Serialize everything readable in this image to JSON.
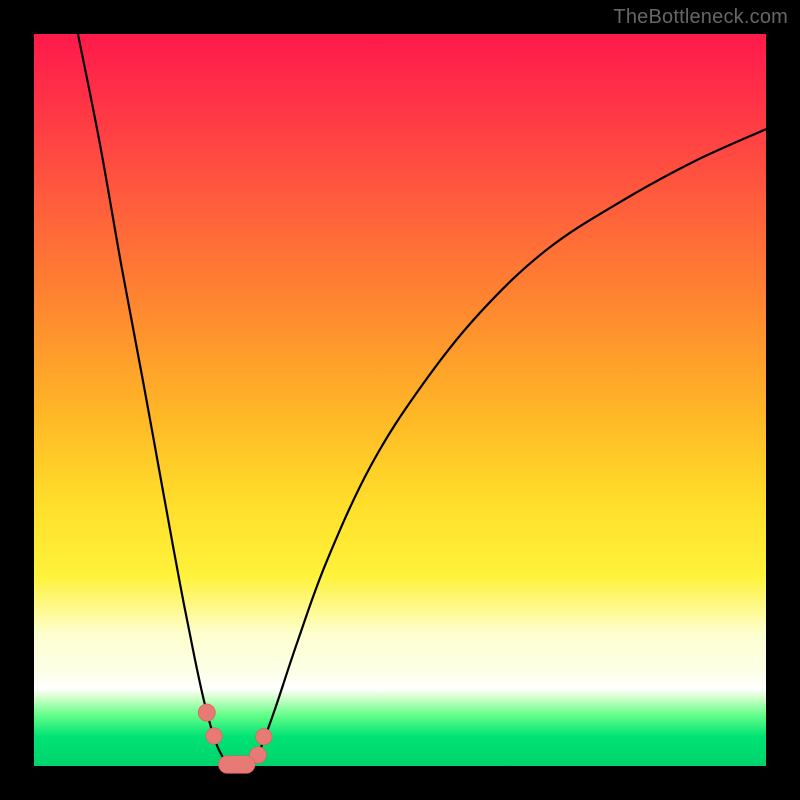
{
  "watermark": "TheBottleneck.com",
  "chart_data": {
    "type": "line",
    "title": "",
    "xlabel": "",
    "ylabel": "",
    "xlim": [
      0,
      100
    ],
    "ylim": [
      0,
      100
    ],
    "grid": false,
    "legend": false,
    "series": [
      {
        "name": "left-branch",
        "x": [
          6,
          9,
          12,
          15,
          17,
          19,
          20.5,
          22,
          23.2,
          24.2,
          25,
          25.8,
          26.4
        ],
        "values": [
          100,
          85,
          68,
          52,
          41,
          30,
          22,
          14.5,
          9,
          5.2,
          2.8,
          1.2,
          0.3
        ]
      },
      {
        "name": "right-branch",
        "x": [
          30,
          31,
          33,
          36,
          40,
          46,
          53,
          61,
          70,
          80,
          90,
          100
        ],
        "values": [
          0.3,
          2.5,
          8,
          17,
          28,
          41,
          52,
          62,
          70.5,
          77,
          82.5,
          87
        ]
      }
    ],
    "flat_bottom": {
      "x_start": 26.4,
      "x_end": 30,
      "y": 0
    },
    "markers": [
      {
        "name": "left-upper-dot",
        "x": 23.6,
        "y": 7.3,
        "r": 1.3
      },
      {
        "name": "left-lower-dot",
        "x": 24.6,
        "y": 4.1,
        "r": 1.1
      },
      {
        "name": "right-upper-dot",
        "x": 31.4,
        "y": 4.0,
        "r": 1.1
      },
      {
        "name": "right-lower-dot",
        "x": 30.6,
        "y": 1.5,
        "r": 1.2
      }
    ],
    "bottom_pill": {
      "x_start": 25.2,
      "x_end": 30.2,
      "y": 0.2,
      "thickness": 2.4
    }
  }
}
